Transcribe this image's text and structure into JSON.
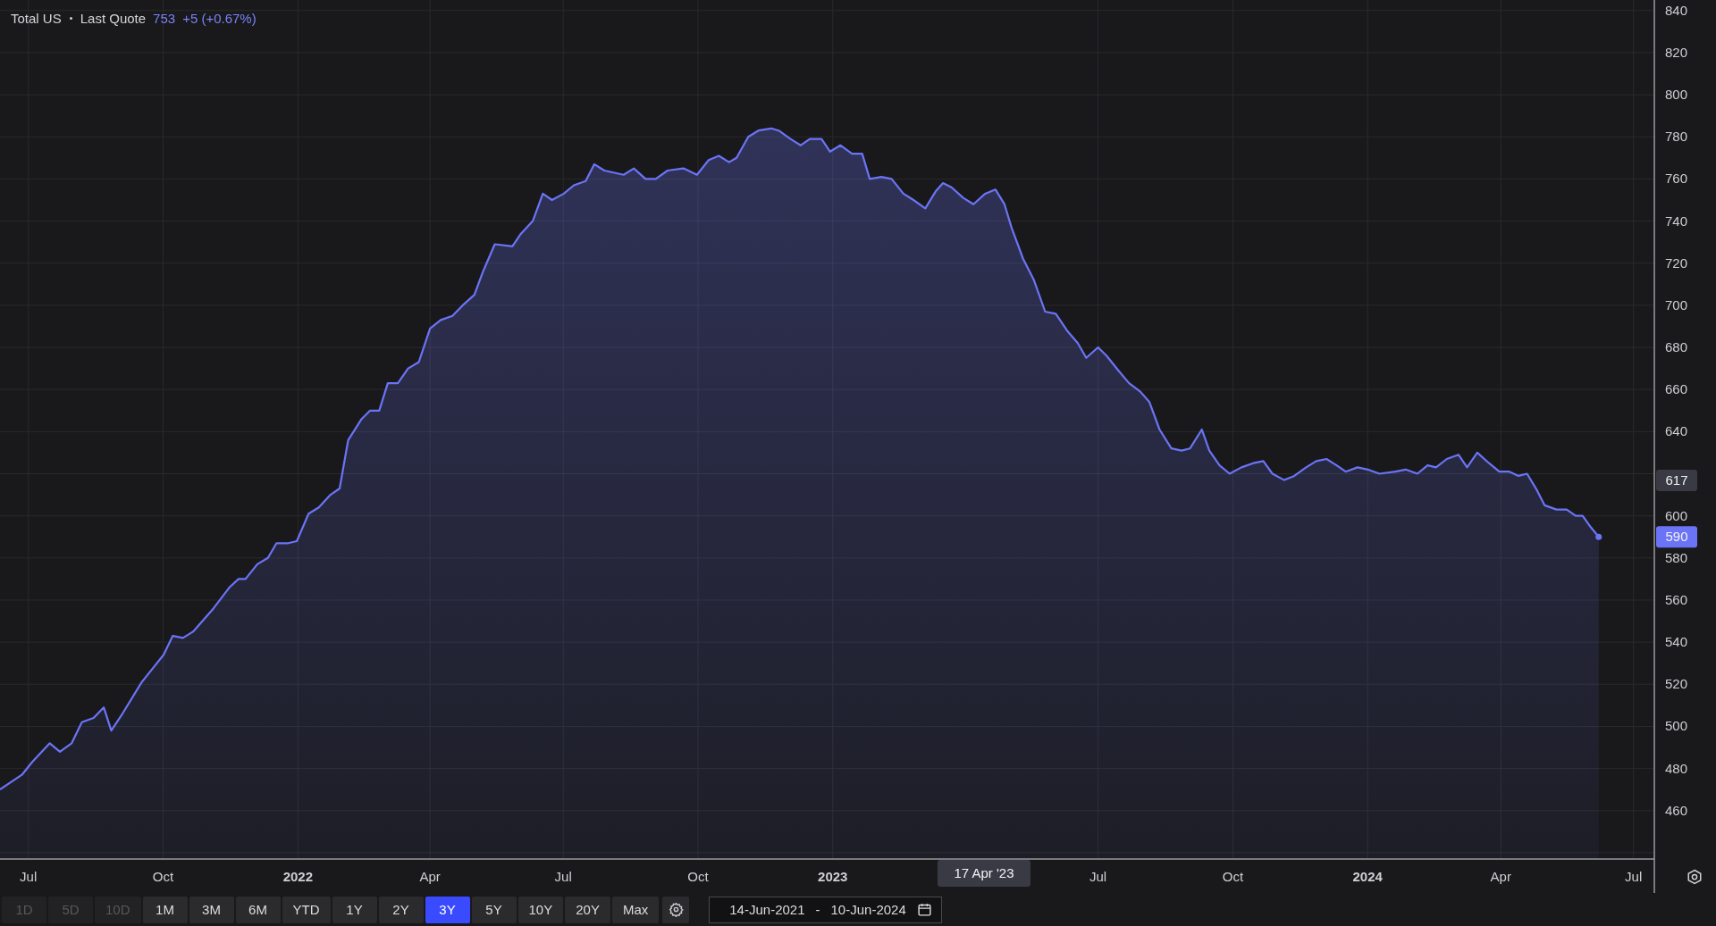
{
  "header": {
    "label": "Last Quote",
    "value": "753",
    "change": "+5 (+0.67%)"
  },
  "chart_data": {
    "type": "area",
    "xlim": [
      2021.443,
      2024.536
    ],
    "ylim": [
      437,
      845
    ],
    "xticks": [
      {
        "value": 2021.496,
        "label": "Jul"
      },
      {
        "value": 2021.748,
        "label": "Oct"
      },
      {
        "value": 2022,
        "label": "2022"
      },
      {
        "value": 2022.247,
        "label": "Apr"
      },
      {
        "value": 2022.496,
        "label": "Jul"
      },
      {
        "value": 2022.748,
        "label": "Oct"
      },
      {
        "value": 2023,
        "label": "2023"
      },
      {
        "value": 2023.496,
        "label": "Jul"
      },
      {
        "value": 2023.748,
        "label": "Oct"
      },
      {
        "value": 2024,
        "label": "2024"
      },
      {
        "value": 2024.249,
        "label": "Apr"
      },
      {
        "value": 2024.497,
        "label": "Jul"
      }
    ],
    "yticks": [
      460,
      480,
      500,
      520,
      540,
      560,
      580,
      600,
      640,
      660,
      680,
      700,
      720,
      740,
      760,
      780,
      800,
      820,
      840
    ],
    "x": [
      2021.443,
      2021.484,
      2021.503,
      2021.536,
      2021.555,
      2021.577,
      2021.596,
      2021.618,
      2021.637,
      2021.651,
      2021.672,
      2021.708,
      2021.73,
      2021.749,
      2021.766,
      2021.785,
      2021.804,
      2021.842,
      2021.872,
      2021.889,
      2021.902,
      2021.924,
      2021.944,
      2021.96,
      2021.982,
      2021.998,
      2022.02,
      2022.039,
      2022.061,
      2022.078,
      2022.094,
      2022.119,
      2022.135,
      2022.152,
      2022.168,
      2022.187,
      2022.206,
      2022.226,
      2022.247,
      2022.267,
      2022.289,
      2022.308,
      2022.33,
      2022.346,
      2022.368,
      2022.401,
      2022.417,
      2022.439,
      2022.458,
      2022.475,
      2022.497,
      2022.516,
      2022.538,
      2022.554,
      2022.573,
      2022.609,
      2022.628,
      2022.65,
      2022.669,
      2022.691,
      2022.721,
      2022.746,
      2022.768,
      2022.787,
      2022.806,
      2022.82,
      2022.842,
      2022.861,
      2022.885,
      2022.899,
      2022.921,
      2022.94,
      2022.957,
      2022.979,
      2022.995,
      2023.014,
      2023.036,
      2023.055,
      2023.069,
      2023.091,
      2023.11,
      2023.132,
      2023.151,
      2023.173,
      2023.192,
      2023.206,
      2023.222,
      2023.244,
      2023.263,
      2023.285,
      2023.304,
      2023.321,
      2023.334,
      2023.356,
      2023.376,
      2023.397,
      2023.417,
      2023.438,
      2023.458,
      2023.474,
      2023.496,
      2023.512,
      2023.534,
      2023.554,
      2023.575,
      2023.592,
      2023.611,
      2023.633,
      2023.652,
      2023.668,
      2023.69,
      2023.704,
      2023.723,
      2023.742,
      2023.764,
      2023.786,
      2023.805,
      2023.822,
      2023.844,
      2023.863,
      2023.885,
      2023.904,
      2023.923,
      2023.942,
      2023.959,
      2023.981,
      2024.0,
      2024.022,
      2024.052,
      2024.071,
      2024.093,
      2024.112,
      2024.128,
      2024.148,
      2024.17,
      2024.186,
      2024.205,
      2024.227,
      2024.246,
      2024.265,
      2024.282,
      2024.298,
      2024.317,
      2024.331,
      2024.353,
      2024.372,
      2024.389,
      2024.402,
      2024.416,
      2024.432
    ],
    "series": [
      {
        "name": "Total US",
        "color": "#6b74f6",
        "values": [
          470,
          477,
          483,
          492,
          488,
          492,
          502,
          504,
          509,
          498,
          506,
          521,
          528,
          534,
          543,
          542,
          545,
          556,
          566,
          570,
          570,
          577,
          580,
          587,
          587,
          588,
          601,
          604,
          610,
          613,
          636,
          646,
          650,
          650,
          663,
          663,
          670,
          673,
          689,
          693,
          695,
          700,
          705,
          716,
          729,
          728,
          734,
          740,
          753,
          750,
          753,
          757,
          759,
          767,
          764,
          762,
          765,
          760,
          760,
          764,
          765,
          762,
          769,
          771,
          768,
          770,
          780,
          783,
          784,
          783,
          779,
          776,
          779,
          779,
          773,
          776,
          772,
          772,
          760,
          761,
          760,
          753,
          750,
          746,
          754,
          758,
          756,
          751,
          748,
          753,
          755,
          748,
          737,
          722,
          712,
          697,
          696,
          688,
          682,
          675,
          680,
          676,
          669,
          663,
          659,
          654,
          641,
          632,
          631,
          632,
          641,
          631,
          624,
          620,
          623,
          625,
          626,
          620,
          617,
          619,
          623,
          626,
          627,
          624,
          621,
          623,
          622,
          620,
          621,
          622,
          620,
          624,
          623,
          627,
          629,
          623,
          630,
          625,
          621,
          621,
          619,
          620,
          612,
          605,
          603,
          603,
          600,
          600,
          595,
          590
        ]
      }
    ],
    "grid": true,
    "annotations": [
      "590"
    ]
  },
  "crosshair": {
    "price": "617",
    "date": "17 Apr '23"
  },
  "ranges": [
    {
      "label": "1D",
      "selected": false,
      "disabled": true
    },
    {
      "label": "5D",
      "selected": false,
      "disabled": true
    },
    {
      "label": "10D",
      "selected": false,
      "disabled": true
    },
    {
      "label": "1M",
      "selected": false,
      "disabled": false
    },
    {
      "label": "3M",
      "selected": false,
      "disabled": false
    },
    {
      "label": "6M",
      "selected": false,
      "disabled": false
    },
    {
      "label": "YTD",
      "selected": false,
      "disabled": false
    },
    {
      "label": "1Y",
      "selected": false,
      "disabled": false
    },
    {
      "label": "2Y",
      "selected": false,
      "disabled": false
    },
    {
      "label": "3Y",
      "selected": true,
      "disabled": false
    },
    {
      "label": "5Y",
      "selected": false,
      "disabled": false
    },
    {
      "label": "10Y",
      "selected": false,
      "disabled": false
    },
    {
      "label": "20Y",
      "selected": false,
      "disabled": false
    },
    {
      "label": "Max",
      "selected": false,
      "disabled": false
    }
  ],
  "date_range": {
    "start": "14-Jun-2021",
    "separator": "-",
    "end": "10-Jun-2024"
  }
}
